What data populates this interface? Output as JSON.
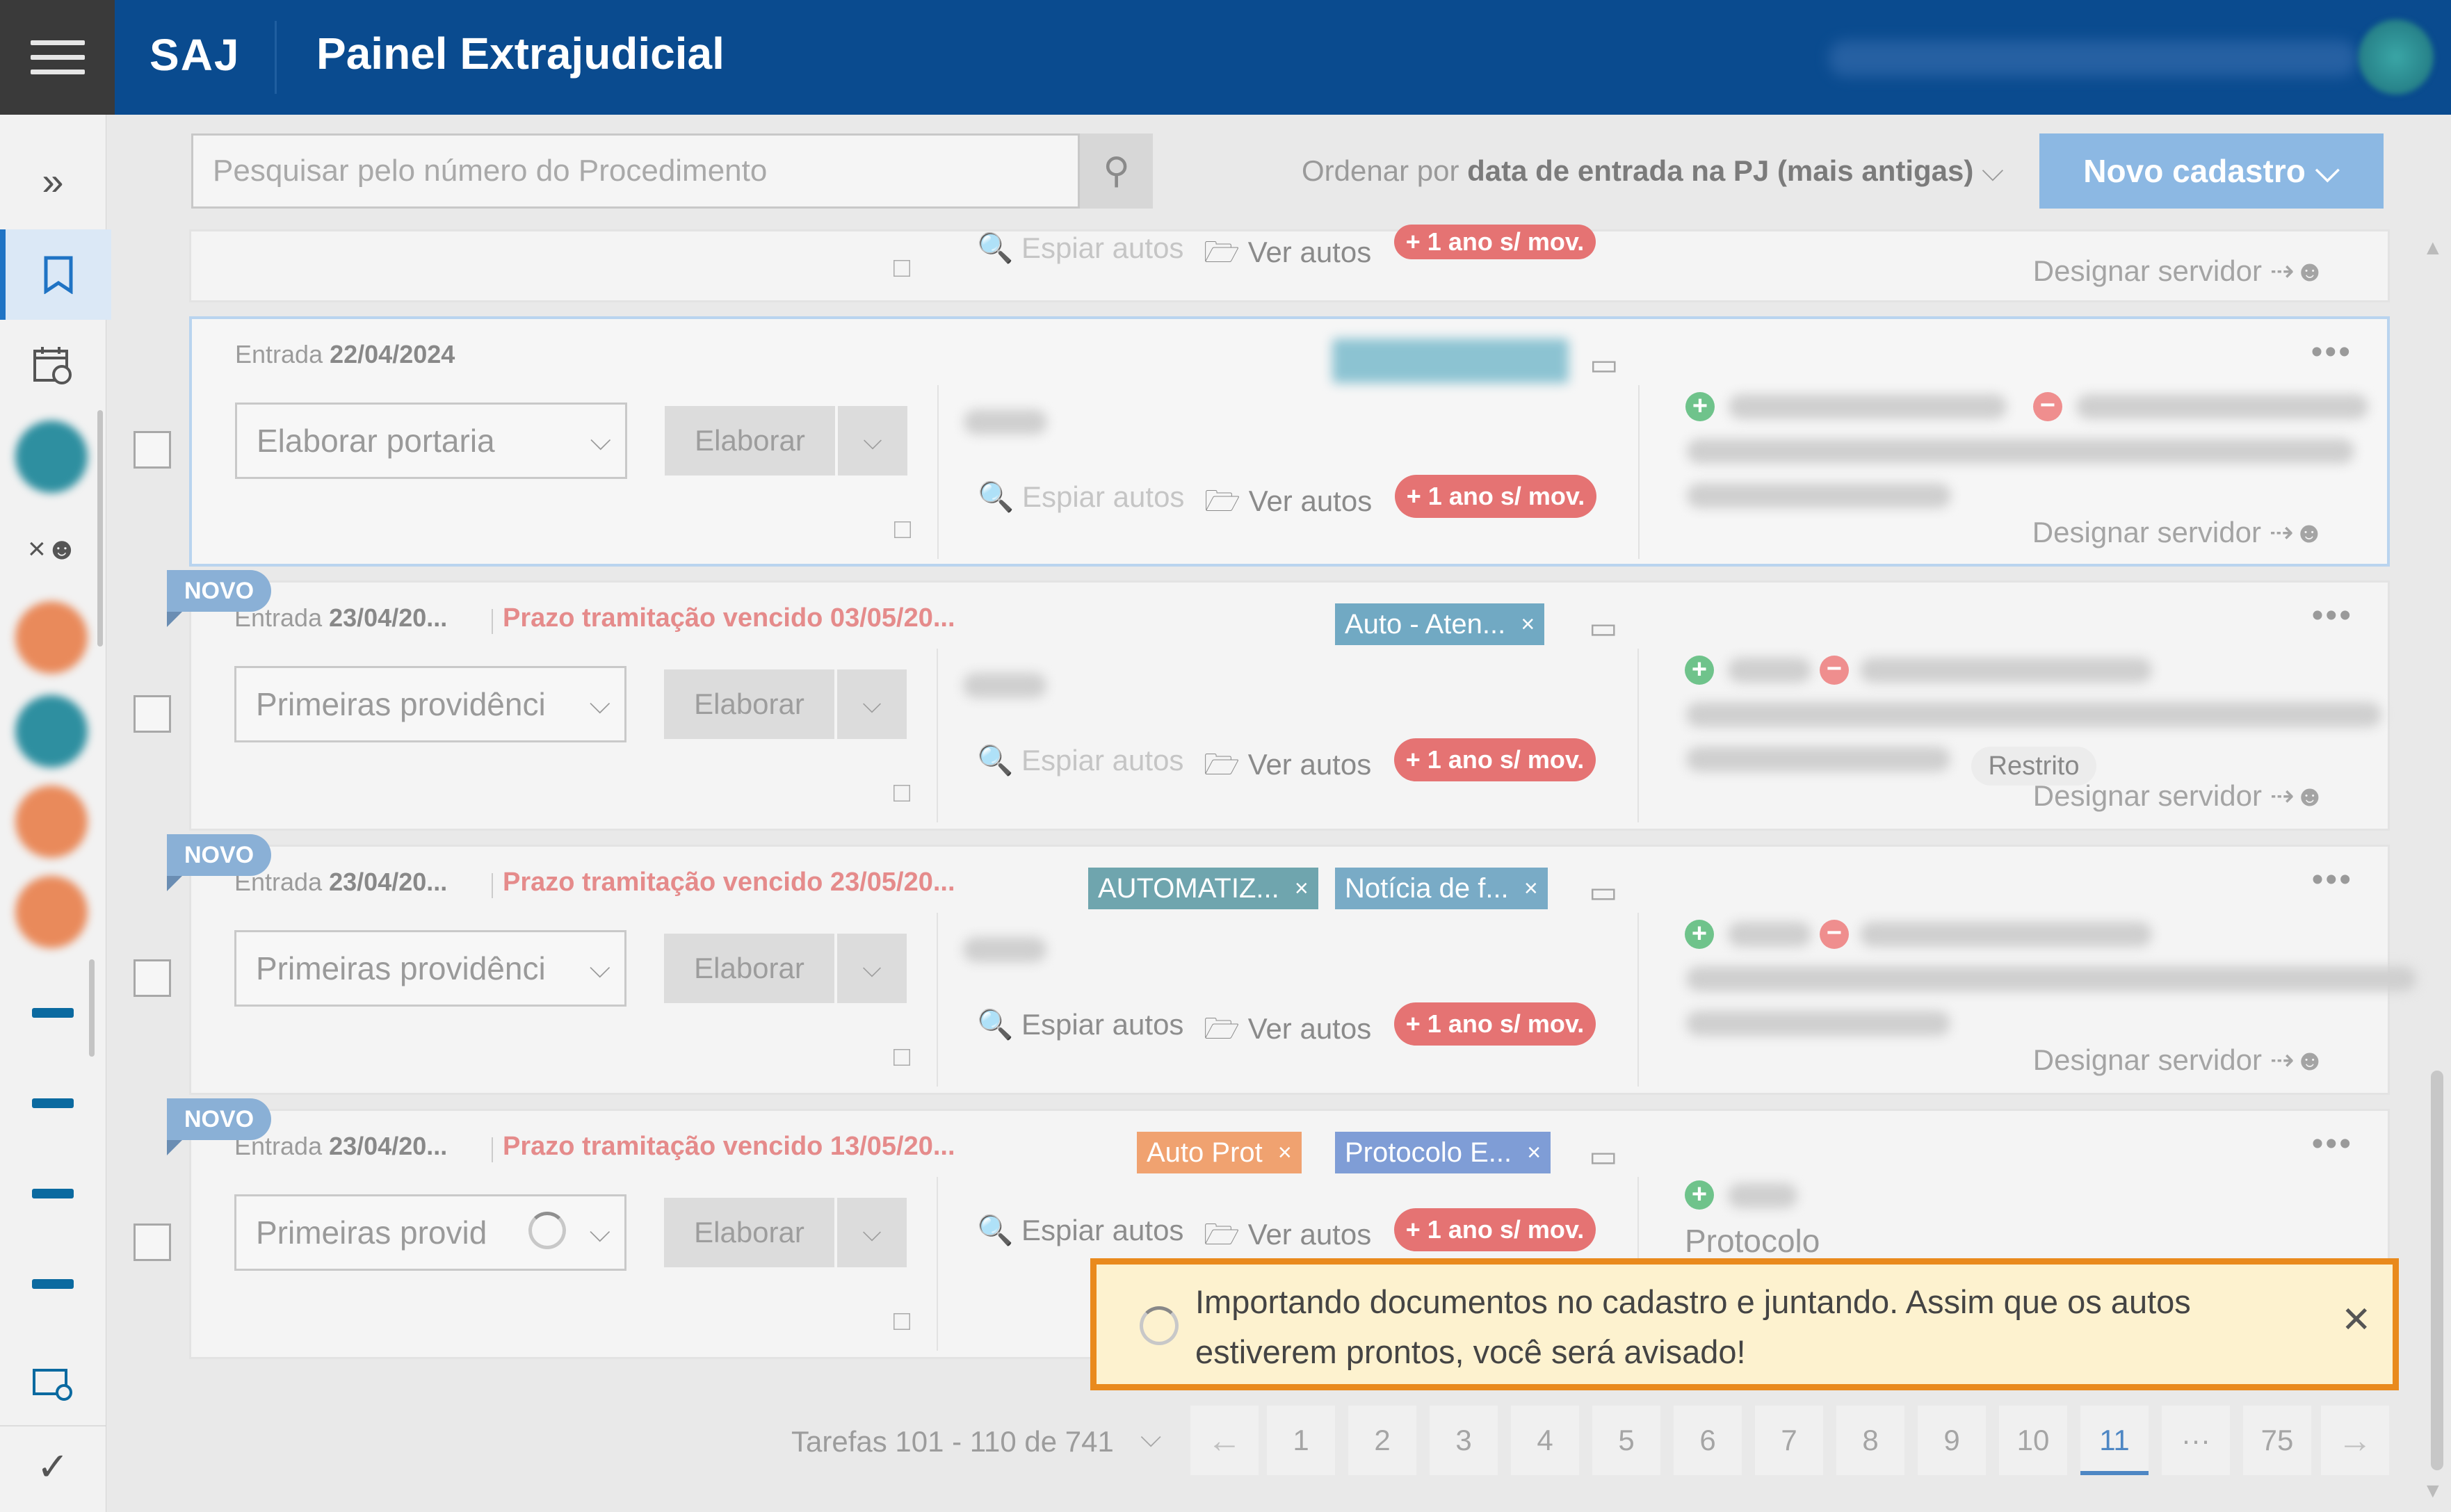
{
  "header": {
    "brand": "SAJ",
    "title": "Painel Extrajudicial"
  },
  "toolbar": {
    "search_placeholder": "Pesquisar pelo número do Procedimento",
    "sort_prefix": "Ordenar por",
    "sort_value": "data de entrada na PJ (mais antigas)",
    "new_button": "Novo cadastro"
  },
  "labels": {
    "elaborar": "Elaborar",
    "espiar_autos": "Espiar autos",
    "ver_autos": "Ver autos",
    "mov_badge": "+ 1 ano s/ mov.",
    "designar": "Designar servidor",
    "novo": "NOVO",
    "restrito": "Restrito",
    "protocolo": "Protocolo"
  },
  "cards": [
    {
      "entry_label": "Entrada",
      "entry_date": "22/04/2024",
      "action": "Elaborar portaria",
      "tags": []
    },
    {
      "entry_label": "Entrada",
      "entry_date": "23/04/20...",
      "deadline": "Prazo tramitação vencido 03/05/20...",
      "action": "Primeiras providênci",
      "tags": [
        {
          "label": "Auto - Aten...",
          "color": "#71a9c3"
        }
      ]
    },
    {
      "entry_label": "Entrada",
      "entry_date": "23/04/20...",
      "deadline": "Prazo tramitação vencido 23/05/20...",
      "action": "Primeiras providênci",
      "tags": [
        {
          "label": "AUTOMATIZ...",
          "color": "#6fa5ae"
        },
        {
          "label": "Notícia de f...",
          "color": "#79abc6"
        }
      ]
    },
    {
      "entry_label": "Entrada",
      "entry_date": "23/04/20...",
      "deadline": "Prazo tramitação vencido 13/05/20...",
      "action": "Primeiras provid",
      "tags": [
        {
          "label": "Auto Prot",
          "color": "#f0a270"
        },
        {
          "label": "Protocolo E...",
          "color": "#7f9dd6"
        }
      ]
    }
  ],
  "toast": {
    "message": "Importando documentos no cadastro e juntando. Assim que os autos estiverem prontos, você será avisado!"
  },
  "pagination": {
    "info": "Tarefas 101 - 110 de 741",
    "pages": [
      "1",
      "2",
      "3",
      "4",
      "5",
      "6",
      "7",
      "8",
      "9",
      "10",
      "11"
    ],
    "ellipsis": "···",
    "last": "75",
    "current": "11"
  },
  "colors": {
    "header_bg": "#0a4b8f",
    "accent": "#4e87c4",
    "badge_red": "#e57373",
    "toast_border": "#e98a1d"
  }
}
